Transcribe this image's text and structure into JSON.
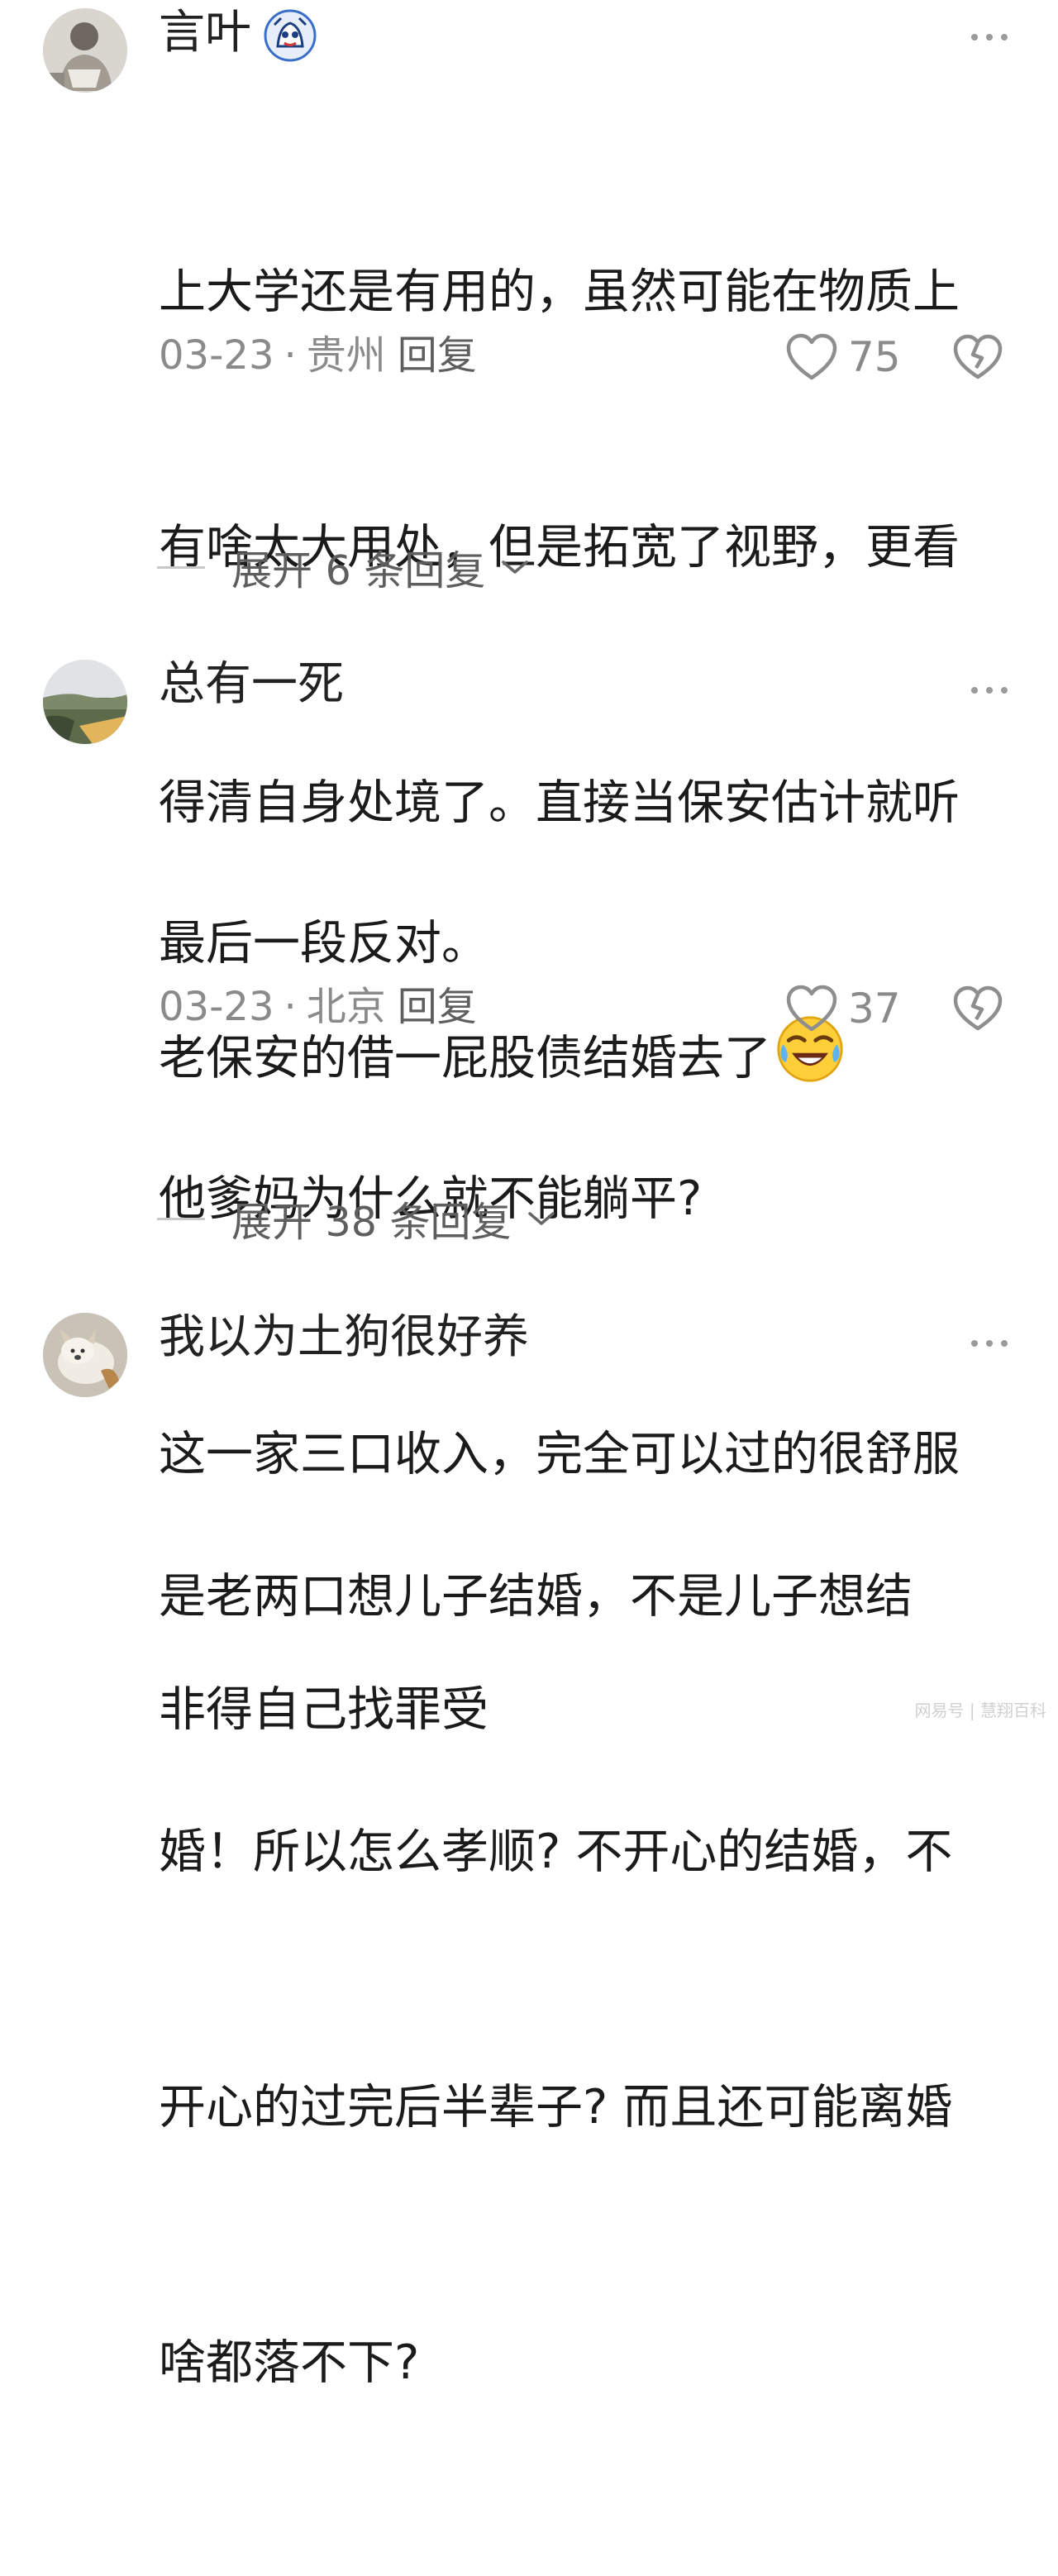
{
  "comments": [
    {
      "username": "言叶",
      "lines": [
        "上大学还是有用的，虽然可能在物质上",
        "有啥太大用处，但是拓宽了视野，更看",
        "得清自身处境了。直接当保安估计就听",
        "老保安的借一屁股债结婚去了"
      ],
      "date": "03-23",
      "location": "贵州",
      "reply_label": "回复",
      "likes": "75",
      "expand_label": "展开 6 条回复",
      "has_badge": true,
      "emoji": "laughing-crying-emoji"
    },
    {
      "username": "总有一死",
      "lines": [
        "最后一段反对。",
        "他爹妈为什么就不能躺平?",
        "这一家三口收入，完全可以过的很舒服",
        "非得自己找罪受"
      ],
      "date": "03-23",
      "location": "北京",
      "reply_label": "回复",
      "likes": "37",
      "expand_label": "展开 38 条回复"
    },
    {
      "username": "我以为土狗很好养",
      "lines": [
        "是老两口想儿子结婚，不是儿子想结",
        "婚！所以怎么孝顺? 不开心的结婚，不",
        "开心的过完后半辈子? 而且还可能离婚",
        "啥都落不下?"
      ]
    }
  ],
  "separator_dot": "·",
  "watermark": "网易号 | 慧翔百科",
  "colors": {
    "text": "#1b1b1b",
    "meta": "#8a8a8a",
    "expand": "#5e5e5e",
    "background": "#ffffff"
  }
}
